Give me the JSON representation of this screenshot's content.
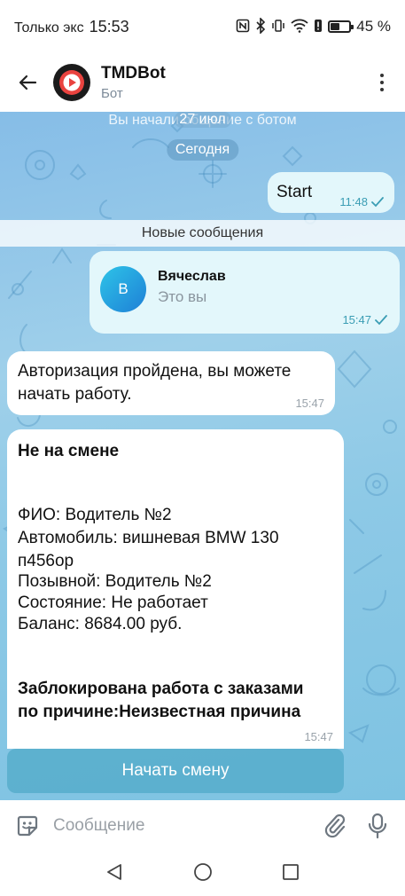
{
  "status_bar": {
    "carrier": "Только экс",
    "time": "15:53",
    "battery": "45 %"
  },
  "header": {
    "title": "TMDBot",
    "subtitle": "Бот"
  },
  "chat": {
    "service_started": "Вы начали общение с ботом",
    "date_overlay": "27 июл",
    "date_today": "Сегодня",
    "start_message": {
      "text": "Start",
      "time": "11:48"
    },
    "new_messages_label": "Новые сообщения",
    "contact_message": {
      "avatar_letter": "В",
      "name": "Вячеслав",
      "subtitle": "Это вы",
      "time": "15:47"
    },
    "auth_message": {
      "line1": "Авторизация пройдена, вы можете",
      "line2": "начать работу.",
      "time": "15:47"
    },
    "status_message": {
      "heading": "Не на смене",
      "fio": "ФИО: Водитель №2",
      "car_line1": "Автомобиль: вишневая BMW 130",
      "car_line2": "п456ор",
      "callsign": "Позывной: Водитель №2",
      "state": "Состояние: Не работает",
      "balance": "Баланс: 8684.00 руб.",
      "blocked_line1": "Заблокирована работа с заказами",
      "blocked_line2": "по причине:Неизвестная причина",
      "time": "15:47"
    },
    "start_shift_button": "Начать смену"
  },
  "input": {
    "placeholder": "Сообщение"
  },
  "colors": {
    "chat_bg": "#8dc9e6",
    "outgoing_bubble": "#e3f7fb",
    "incoming_bubble": "#ffffff",
    "accent": "#3a9db4"
  },
  "icons": [
    "back-arrow-icon",
    "bot-avatar-icon",
    "more-vert-icon",
    "sticker-icon",
    "attach-icon",
    "mic-icon",
    "nav-back-icon",
    "nav-home-icon",
    "nav-recents-icon"
  ]
}
